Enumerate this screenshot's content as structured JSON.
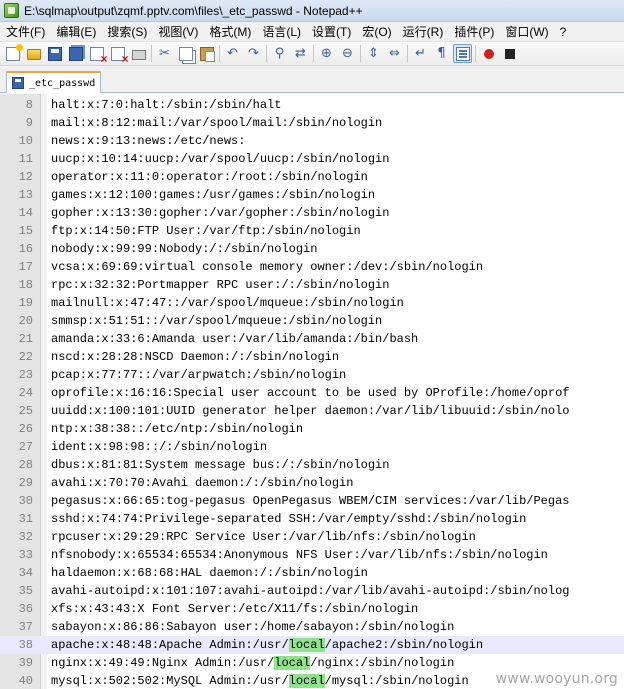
{
  "window": {
    "title": "E:\\sqlmap\\output\\zqmf.pptv.com\\files\\_etc_passwd - Notepad++"
  },
  "menu": [
    "文件(F)",
    "编辑(E)",
    "搜索(S)",
    "视图(V)",
    "格式(M)",
    "语言(L)",
    "设置(T)",
    "宏(O)",
    "运行(R)",
    "插件(P)",
    "窗口(W)",
    "?"
  ],
  "toolbar": {
    "icons": [
      "new-file-icon",
      "open-file-icon",
      "save-icon",
      "save-all-icon",
      "close-icon",
      "close-all-icon",
      "print-icon",
      "cut-icon",
      "copy-icon",
      "paste-icon",
      "undo-icon",
      "redo-icon",
      "find-icon",
      "replace-icon",
      "zoom-in-icon",
      "zoom-out-icon",
      "sync-vertical-icon",
      "sync-horizontal-icon",
      "word-wrap-icon",
      "show-all-chars-icon",
      "indent-guide-icon",
      "record-macro-icon",
      "stop-record-icon"
    ]
  },
  "tab": {
    "label": "_etc_passwd"
  },
  "editor": {
    "current_line": 38,
    "highlight_term": "local",
    "lines": [
      {
        "num": "8",
        "text": "halt:x:7:0:halt:/sbin:/sbin/halt"
      },
      {
        "num": "9",
        "text": "mail:x:8:12:mail:/var/spool/mail:/sbin/nologin"
      },
      {
        "num": "10",
        "text": "news:x:9:13:news:/etc/news:"
      },
      {
        "num": "11",
        "text": "uucp:x:10:14:uucp:/var/spool/uucp:/sbin/nologin"
      },
      {
        "num": "12",
        "text": "operator:x:11:0:operator:/root:/sbin/nologin"
      },
      {
        "num": "13",
        "text": "games:x:12:100:games:/usr/games:/sbin/nologin"
      },
      {
        "num": "14",
        "text": "gopher:x:13:30:gopher:/var/gopher:/sbin/nologin"
      },
      {
        "num": "15",
        "text": "ftp:x:14:50:FTP User:/var/ftp:/sbin/nologin"
      },
      {
        "num": "16",
        "text": "nobody:x:99:99:Nobody:/:/sbin/nologin"
      },
      {
        "num": "17",
        "text": "vcsa:x:69:69:virtual console memory owner:/dev:/sbin/nologin"
      },
      {
        "num": "18",
        "text": "rpc:x:32:32:Portmapper RPC user:/:/sbin/nologin"
      },
      {
        "num": "19",
        "text": "mailnull:x:47:47::/var/spool/mqueue:/sbin/nologin"
      },
      {
        "num": "20",
        "text": "smmsp:x:51:51::/var/spool/mqueue:/sbin/nologin"
      },
      {
        "num": "21",
        "text": "amanda:x:33:6:Amanda user:/var/lib/amanda:/bin/bash"
      },
      {
        "num": "22",
        "text": "nscd:x:28:28:NSCD Daemon:/:/sbin/nologin"
      },
      {
        "num": "23",
        "text": "pcap:x:77:77::/var/arpwatch:/sbin/nologin"
      },
      {
        "num": "24",
        "text": "oprofile:x:16:16:Special user account to be used by OProfile:/home/oprof"
      },
      {
        "num": "25",
        "text": "uuidd:x:100:101:UUID generator helper daemon:/var/lib/libuuid:/sbin/nolo"
      },
      {
        "num": "26",
        "text": "ntp:x:38:38::/etc/ntp:/sbin/nologin"
      },
      {
        "num": "27",
        "text": "ident:x:98:98::/:/sbin/nologin"
      },
      {
        "num": "28",
        "text": "dbus:x:81:81:System message bus:/:/sbin/nologin"
      },
      {
        "num": "29",
        "text": "avahi:x:70:70:Avahi daemon:/:/sbin/nologin"
      },
      {
        "num": "30",
        "text": "pegasus:x:66:65:tog-pegasus OpenPegasus WBEM/CIM services:/var/lib/Pegas"
      },
      {
        "num": "31",
        "text": "sshd:x:74:74:Privilege-separated SSH:/var/empty/sshd:/sbin/nologin"
      },
      {
        "num": "32",
        "text": "rpcuser:x:29:29:RPC Service User:/var/lib/nfs:/sbin/nologin"
      },
      {
        "num": "33",
        "text": "nfsnobody:x:65534:65534:Anonymous NFS User:/var/lib/nfs:/sbin/nologin"
      },
      {
        "num": "34",
        "text": "haldaemon:x:68:68:HAL daemon:/:/sbin/nologin"
      },
      {
        "num": "35",
        "text": "avahi-autoipd:x:101:107:avahi-autoipd:/var/lib/avahi-autoipd:/sbin/nolog"
      },
      {
        "num": "36",
        "text": "xfs:x:43:43:X Font Server:/etc/X11/fs:/sbin/nologin"
      },
      {
        "num": "37",
        "text": "sabayon:x:86:86:Sabayon user:/home/sabayon:/sbin/nologin"
      },
      {
        "num": "38",
        "pre": "apache:x:48:48:Apache Admin:/usr/",
        "mark": "local",
        "post": "/apache2:/sbin/nologin"
      },
      {
        "num": "39",
        "pre": "nginx:x:49:49:Nginx Admin:/usr/",
        "mark": "local",
        "post": "/nginx:/sbin/nologin"
      },
      {
        "num": "40",
        "pre": "mysql:x:502:502:MySQL Admin:/usr/",
        "mark": "local",
        "post": "/mysql:/sbin/nologin"
      }
    ]
  },
  "watermark": "www.wooyun.org"
}
